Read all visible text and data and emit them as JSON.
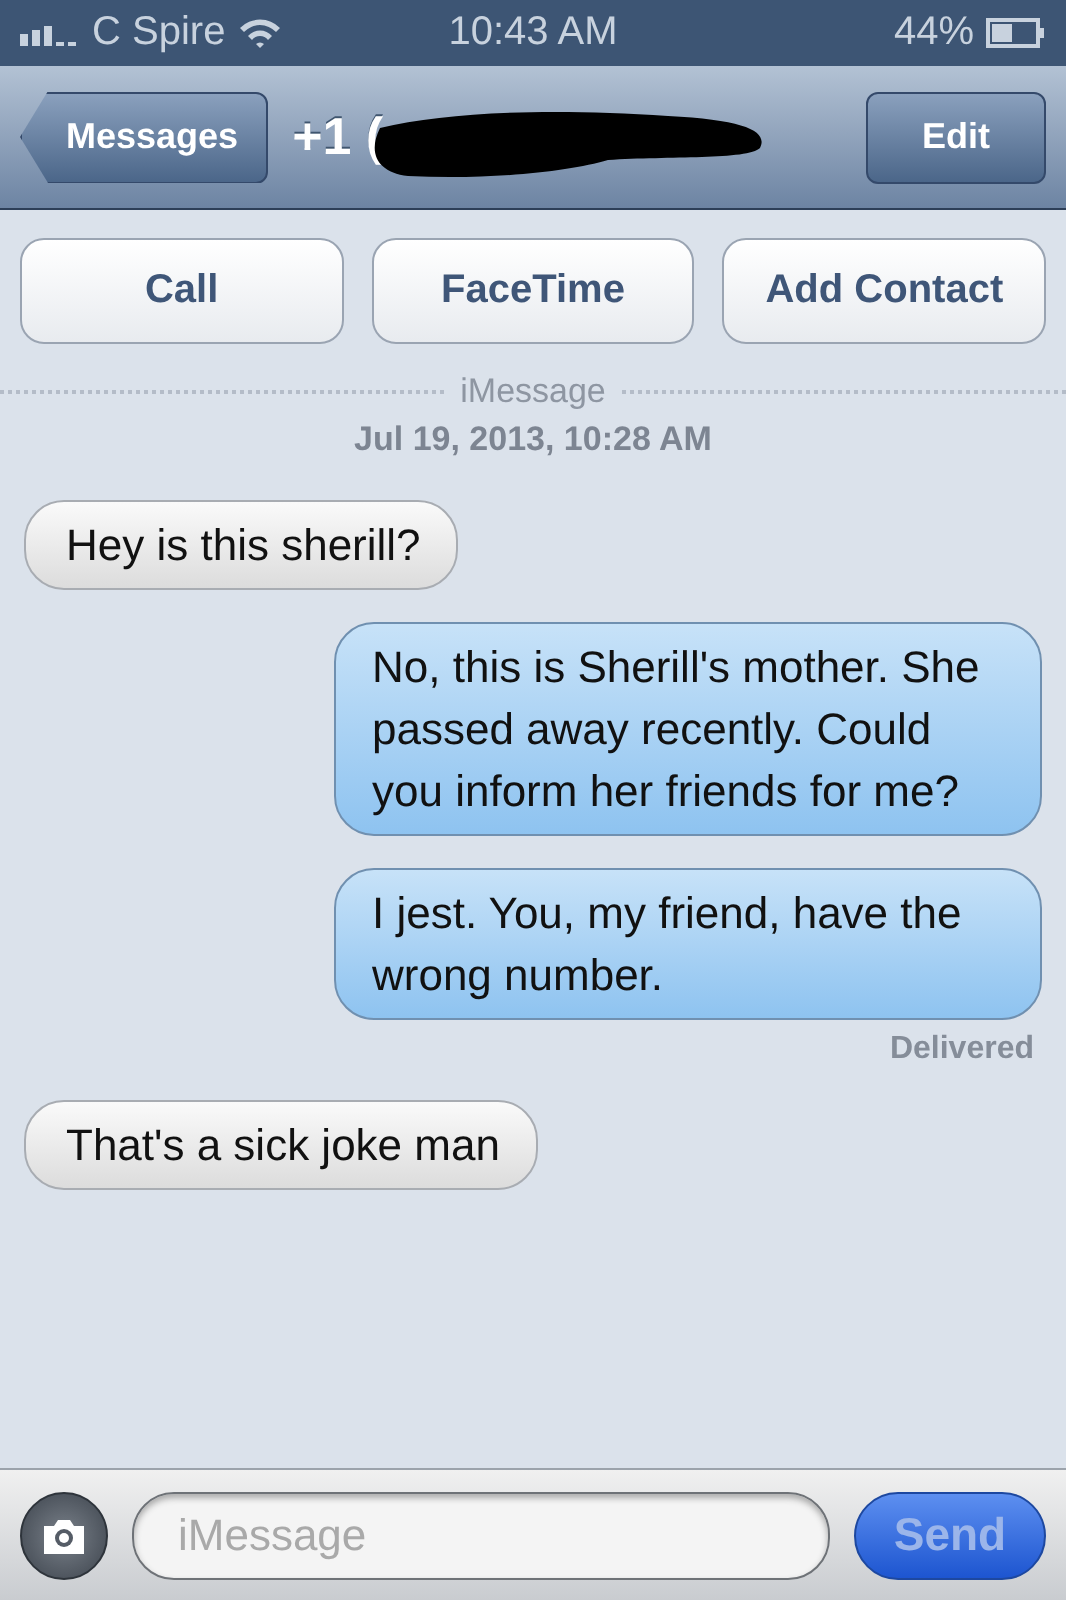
{
  "status_bar": {
    "carrier": "C Spire",
    "time": "10:43 AM",
    "battery": "44%"
  },
  "nav_bar": {
    "back": "Messages",
    "title": "+1 (",
    "edit": "Edit"
  },
  "actions": [
    "Call",
    "FaceTime",
    "Add Contact"
  ],
  "service": "iMessage",
  "timestamp": "Jul 19, 2013, 10:28 AM",
  "messages": [
    {
      "kind": "incoming",
      "text": "Hey is this sherill?"
    },
    {
      "kind": "outgoing",
      "text": "No, this is Sherill's mother. She passed away recently. Could you inform her friends for me?"
    },
    {
      "kind": "outgoing",
      "text": "I jest. You, my friend, have the wrong number."
    },
    {
      "kind": "status",
      "text": "Delivered"
    },
    {
      "kind": "incoming",
      "text": "That's a sick joke man"
    }
  ],
  "compose": {
    "placeholder": "iMessage",
    "send": "Send",
    "send_disabled": true
  }
}
